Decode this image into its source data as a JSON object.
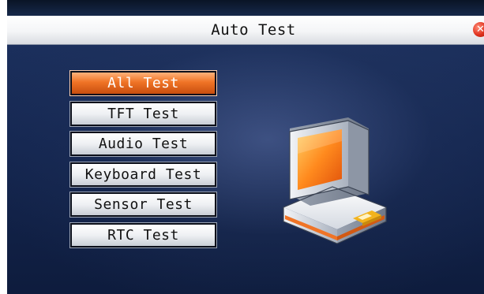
{
  "window": {
    "title": "Auto Test",
    "close_icon": "close-icon"
  },
  "menu": {
    "items": [
      {
        "label": "All Test",
        "selected": true
      },
      {
        "label": "TFT Test",
        "selected": false
      },
      {
        "label": "Audio Test",
        "selected": false
      },
      {
        "label": "Keyboard Test",
        "selected": false
      },
      {
        "label": "Sensor Test",
        "selected": false
      },
      {
        "label": "RTC Test",
        "selected": false
      }
    ]
  },
  "illustration": {
    "icon": "computer-icon"
  },
  "colors": {
    "accent": "#f07426",
    "background": "#142650",
    "title_bar": "#f4f5f7",
    "close_button": "#e0311d"
  }
}
